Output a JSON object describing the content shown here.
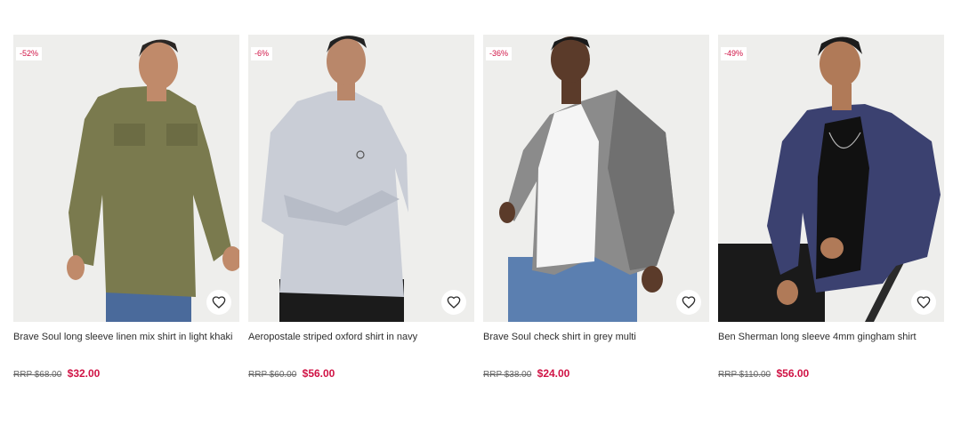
{
  "products": [
    {
      "discount": "-52%",
      "title": "Brave Soul long sleeve linen mix shirt in light khaki",
      "rrp": "RRP $68.00",
      "price": "$32.00",
      "shirt_color": "#7a7a4e"
    },
    {
      "discount": "-6%",
      "title": "Aeropostale striped oxford shirt in navy",
      "rrp": "RRP $60.00",
      "price": "$56.00",
      "shirt_color": "#c9cdd6"
    },
    {
      "discount": "-36%",
      "title": "Brave Soul check shirt in grey multi",
      "rrp": "RRP $38.00",
      "price": "$24.00",
      "shirt_color": "#8b8b8b"
    },
    {
      "discount": "-49%",
      "title": "Ben Sherman long sleeve 4mm gingham shirt",
      "rrp": "RRP $110.00",
      "price": "$56.00",
      "shirt_color": "#3b4170"
    }
  ],
  "colors": {
    "accent": "#d01345",
    "image_bg": "#eeeeec",
    "text": "#2d2d2d"
  },
  "icons": {
    "favourite": "heart-icon"
  }
}
